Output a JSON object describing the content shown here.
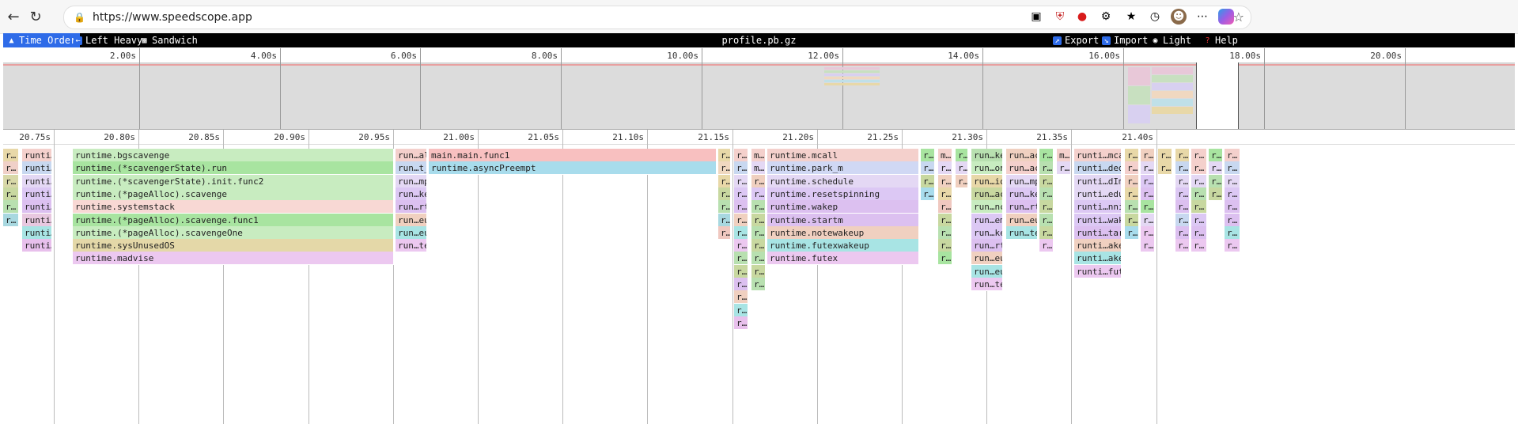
{
  "browser": {
    "url": "https://www.speedscope.app"
  },
  "toolbar": {
    "time_order": "Time Order",
    "left_heavy": "Left Heavy",
    "sandwich": "Sandwich",
    "title": "profile.pb.gz",
    "export": "Export",
    "import": "Import",
    "light": "Light",
    "help": "Help"
  },
  "minimap": {
    "ticks": [
      {
        "label": "2.00s",
        "t": 2
      },
      {
        "label": "4.00s",
        "t": 4
      },
      {
        "label": "6.00s",
        "t": 6
      },
      {
        "label": "8.00s",
        "t": 8
      },
      {
        "label": "10.00s",
        "t": 10
      },
      {
        "label": "12.00s",
        "t": 12
      },
      {
        "label": "14.00s",
        "t": 14
      },
      {
        "label": "16.00s",
        "t": 16
      },
      {
        "label": "18.00s",
        "t": 18
      },
      {
        "label": "20.00s",
        "t": 20
      }
    ],
    "range": [
      0,
      21.5
    ]
  },
  "flame": {
    "ticks": [
      {
        "label": "20.75s"
      },
      {
        "label": "20.80s"
      },
      {
        "label": "20.85s"
      },
      {
        "label": "20.90s"
      },
      {
        "label": "20.95s"
      },
      {
        "label": "21.00s"
      },
      {
        "label": "21.05s"
      },
      {
        "label": "21.10s"
      },
      {
        "label": "21.15s"
      },
      {
        "label": "21.20s"
      },
      {
        "label": "21.25s"
      },
      {
        "label": "21.30s"
      },
      {
        "label": "21.35s"
      },
      {
        "label": "21.40s"
      }
    ],
    "frames": [
      [
        "r…",
        0,
        "#e8d8a8",
        0,
        20
      ],
      [
        "r…",
        1,
        "#f0d0c8",
        0,
        20
      ],
      [
        "r…",
        2,
        "#d8d8a8",
        0,
        20
      ],
      [
        "r…",
        3,
        "#c8d8a0",
        0,
        20
      ],
      [
        "r…",
        4,
        "#b8e0b0",
        0,
        20
      ],
      [
        "r…",
        5,
        "#a8d8e0",
        0,
        20
      ],
      [
        "runti…mcall",
        0,
        "#f4d0cc",
        24,
        62
      ],
      [
        "runti…ded_m",
        1,
        "#c8d8f0",
        24,
        62
      ],
      [
        "runti…dImpl",
        2,
        "#e4d8f4",
        24,
        62
      ],
      [
        "runti…wakep",
        3,
        "#dcc8f4",
        24,
        62
      ],
      [
        "runti…tartm",
        4,
        "#dcc0f0",
        24,
        62
      ],
      [
        "runti…akeup",
        5,
        "#e8c8e0",
        24,
        62
      ],
      [
        "runti…akeup",
        6,
        "#a8e4e4",
        24,
        62
      ],
      [
        "runti…futex",
        7,
        "#e8c0ec",
        24,
        62
      ],
      [
        "runtime.bgscavenge",
        0,
        "#c8ecc0",
        88,
        494
      ],
      [
        "runtime.(*scavengerState).run",
        1,
        "#a8e4a0",
        88,
        494
      ],
      [
        "runtime.(*scavengerState).init.func2",
        2,
        "#c8ecc0",
        88,
        494
      ],
      [
        "runtime.(*pageAlloc).scavenge",
        3,
        "#c8ecc0",
        88,
        494
      ],
      [
        "runtime.systemstack",
        4,
        "#f8d8d4",
        88,
        494
      ],
      [
        "runtime.(*pageAlloc).scavenge.func1",
        5,
        "#a8e4a0",
        88,
        494
      ],
      [
        "runtime.(*pageAlloc).scavengeOne",
        6,
        "#c8ecc0",
        88,
        494
      ],
      [
        "runtime.sysUnusedOS",
        7,
        "#e4d8a8",
        88,
        494
      ],
      [
        "runtime.madvise",
        8,
        "#ecc8f0",
        88,
        494
      ],
      [
        "run…all",
        0,
        "#f4d0cc",
        496,
        536
      ],
      [
        "run…t_m",
        1,
        "#c8d8f0",
        496,
        536
      ],
      [
        "run…mpl",
        2,
        "#e4d8f4",
        496,
        536
      ],
      [
        "run…kep",
        3,
        "#dcc8f4",
        496,
        536
      ],
      [
        "run…rtm",
        4,
        "#dcc0f0",
        496,
        536
      ],
      [
        "run…eup",
        5,
        "#f0d0c0",
        496,
        536
      ],
      [
        "run…eup",
        6,
        "#a8e4e4",
        496,
        536
      ],
      [
        "run…tex",
        7,
        "#ecc8f0",
        496,
        536
      ],
      [
        "main.main.func1",
        0,
        "#f8c0c0",
        538,
        902
      ],
      [
        "runtime.asyncPreempt",
        1,
        "#a8dcec",
        538,
        902
      ],
      [
        "r…",
        0,
        "#e8d8a8",
        904,
        920
      ],
      [
        "r…",
        1,
        "#f0d8c0",
        904,
        920
      ],
      [
        "r…",
        2,
        "#e8d8a8",
        904,
        920
      ],
      [
        "r…",
        3,
        "#c8d8a0",
        904,
        920
      ],
      [
        "r…",
        4,
        "#b8e0b0",
        904,
        920
      ],
      [
        "r…",
        5,
        "#a8d8e0",
        904,
        920
      ],
      [
        "r…",
        6,
        "#f0c8c0",
        904,
        920
      ],
      [
        "r…",
        0,
        "#f4d0cc",
        924,
        942
      ],
      [
        "r…",
        1,
        "#c8d8f0",
        924,
        942
      ],
      [
        "r…",
        2,
        "#e4d8f4",
        924,
        942
      ],
      [
        "r…",
        3,
        "#dcc8f4",
        924,
        942
      ],
      [
        "r…",
        4,
        "#dcc0f0",
        924,
        942
      ],
      [
        "r…",
        5,
        "#f0d0c0",
        924,
        942
      ],
      [
        "r…",
        6,
        "#a8e4e4",
        924,
        942
      ],
      [
        "r…",
        7,
        "#ecc8f0",
        924,
        942
      ],
      [
        "r…",
        8,
        "#b8e0b0",
        924,
        942
      ],
      [
        "r…",
        9,
        "#c8d8a0",
        924,
        942
      ],
      [
        "r…",
        10,
        "#dcc0f0",
        924,
        942
      ],
      [
        "r…",
        11,
        "#f0d0c0",
        924,
        942
      ],
      [
        "r…",
        12,
        "#a8e4e4",
        924,
        942
      ],
      [
        "r…",
        13,
        "#e8c0ec",
        924,
        942
      ],
      [
        "m…",
        0,
        "#f4d0cc",
        946,
        964
      ],
      [
        "m…",
        1,
        "#e4d8f4",
        946,
        964
      ],
      [
        "r…",
        2,
        "#f0d0c0",
        946,
        964
      ],
      [
        "r…",
        3,
        "#dcc8f4",
        946,
        964
      ],
      [
        "r…",
        4,
        "#b8e0b0",
        946,
        964
      ],
      [
        "r…",
        5,
        "#c8d8a0",
        946,
        964
      ],
      [
        "r…",
        6,
        "#b8e0b0",
        946,
        964
      ],
      [
        "r…",
        7,
        "#c8d8a0",
        946,
        964
      ],
      [
        "r…",
        8,
        "#b8e0b0",
        946,
        964
      ],
      [
        "r…",
        9,
        "#c8d8a0",
        946,
        964
      ],
      [
        "r…",
        10,
        "#b8e0b0",
        946,
        964
      ],
      [
        "runtime.mcall",
        0,
        "#f4d0cc",
        966,
        1158
      ],
      [
        "runtime.park_m",
        1,
        "#d0d8f4",
        966,
        1158
      ],
      [
        "runtime.schedule",
        2,
        "#e4d8f4",
        966,
        1158
      ],
      [
        "runtime.resetspinning",
        3,
        "#dcc8f4",
        966,
        1158
      ],
      [
        "runtime.wakep",
        4,
        "#dcc0f0",
        966,
        1158
      ],
      [
        "runtime.startm",
        5,
        "#dcc0f0",
        966,
        1158
      ],
      [
        "runtime.notewakeup",
        6,
        "#f0d0c0",
        966,
        1158
      ],
      [
        "runtime.futexwakeup",
        7,
        "#a8e4e4",
        966,
        1158
      ],
      [
        "runtime.futex",
        8,
        "#ecc8f0",
        966,
        1158
      ],
      [
        "r…",
        0,
        "#a8e4a0",
        1160,
        1178
      ],
      [
        "r…",
        1,
        "#c8d8f0",
        1160,
        1178
      ],
      [
        "r…",
        2,
        "#c8d8a0",
        1160,
        1178
      ],
      [
        "r…",
        3,
        "#a8dcec",
        1160,
        1178
      ],
      [
        "m…",
        0,
        "#f4d0cc",
        1182,
        1200
      ],
      [
        "r…",
        1,
        "#e4d8f4",
        1182,
        1200
      ],
      [
        "r…",
        2,
        "#f0d0c0",
        1182,
        1200
      ],
      [
        "r…",
        3,
        "#e8d8a8",
        1182,
        1200
      ],
      [
        "r…",
        4,
        "#f0c8c0",
        1182,
        1200
      ],
      [
        "r…",
        5,
        "#c8d8a0",
        1182,
        1200
      ],
      [
        "r…",
        6,
        "#b8e0b0",
        1182,
        1200
      ],
      [
        "r…",
        7,
        "#c8d8a0",
        1182,
        1200
      ],
      [
        "r…",
        8,
        "#a8e4a0",
        1182,
        1200
      ],
      [
        "r…",
        0,
        "#a8e4a0",
        1204,
        1220
      ],
      [
        "r…",
        1,
        "#e4d8f4",
        1204,
        1220
      ],
      [
        "r…",
        2,
        "#f0d0c0",
        1204,
        1220
      ],
      [
        "run…ker",
        0,
        "#b8e0b0",
        1224,
        1264
      ],
      [
        "run…one",
        1,
        "#c8ecc0",
        1224,
        1264
      ],
      [
        "run…ion",
        2,
        "#e8d8a8",
        1224,
        1264
      ],
      [
        "run…ack",
        3,
        "#c8d8a0",
        1224,
        1264
      ],
      [
        "run…nc3",
        4,
        "#c8ecc0",
        1224,
        1264
      ],
      [
        "run…ema",
        5,
        "#dcc8f4",
        1224,
        1264
      ],
      [
        "run…kep",
        6,
        "#dcc8f4",
        1224,
        1264
      ],
      [
        "run…rtm",
        7,
        "#dcc0f0",
        1224,
        1264
      ],
      [
        "run…eup",
        8,
        "#f0d0c0",
        1224,
        1264
      ],
      [
        "run…eup",
        9,
        "#a8e4e4",
        1224,
        1264
      ],
      [
        "run…tex",
        10,
        "#ecc8f0",
        1224,
        1264
      ],
      [
        "run…ack",
        0,
        "#f0d0c0",
        1268,
        1308
      ],
      [
        "run…ack",
        1,
        "#f4d0cc",
        1268,
        1308
      ],
      [
        "run…mpl",
        2,
        "#e4d8f4",
        1268,
        1308
      ],
      [
        "run…kep",
        3,
        "#dcc8f4",
        1268,
        1308
      ],
      [
        "run…rtm",
        4,
        "#dcc0f0",
        1268,
        1308
      ],
      [
        "run…eup",
        5,
        "#f0d0c0",
        1268,
        1308
      ],
      [
        "run…tex",
        6,
        "#a8e4e4",
        1268,
        1308
      ],
      [
        "r…",
        0,
        "#a8e4a0",
        1310,
        1328
      ],
      [
        "r…",
        1,
        "#b8e0b0",
        1310,
        1328
      ],
      [
        "r…",
        2,
        "#c8d8a0",
        1310,
        1328
      ],
      [
        "r…",
        3,
        "#b8e0b0",
        1310,
        1328
      ],
      [
        "r…",
        4,
        "#c8d8a0",
        1310,
        1328
      ],
      [
        "r…",
        5,
        "#b8e0b0",
        1310,
        1328
      ],
      [
        "r…",
        6,
        "#c8d8a0",
        1310,
        1328
      ],
      [
        "r…",
        7,
        "#ecc8f0",
        1310,
        1328
      ],
      [
        "m…",
        0,
        "#f4d0cc",
        1332,
        1350
      ],
      [
        "r…",
        1,
        "#e4d8f4",
        1332,
        1350
      ],
      [
        "runti…mcall",
        0,
        "#f4d0cc",
        1354,
        1414
      ],
      [
        "runti…ded_m",
        1,
        "#c8d8f0",
        1354,
        1414
      ],
      [
        "runti…dImpl",
        2,
        "#e4d8f4",
        1354,
        1414
      ],
      [
        "runti…edule",
        3,
        "#e4d8f4",
        1354,
        1414
      ],
      [
        "runti…nning",
        4,
        "#dcc8f4",
        1354,
        1414
      ],
      [
        "runti…wakep",
        5,
        "#dcc8f4",
        1354,
        1414
      ],
      [
        "runti…tartm",
        6,
        "#dcc0f0",
        1354,
        1414
      ],
      [
        "runti…akeup",
        7,
        "#f0d0c0",
        1354,
        1414
      ],
      [
        "runti…akeup",
        8,
        "#a8e4e4",
        1354,
        1414
      ],
      [
        "runti…futex",
        9,
        "#ecc8f0",
        1354,
        1414
      ],
      [
        "r…",
        0,
        "#e8d8a8",
        1418,
        1436
      ],
      [
        "r…",
        1,
        "#f4d0cc",
        1418,
        1436
      ],
      [
        "r…",
        2,
        "#f0d0c0",
        1418,
        1436
      ],
      [
        "r…",
        3,
        "#e8d8a8",
        1418,
        1436
      ],
      [
        "r…",
        4,
        "#b8e0b0",
        1418,
        1436
      ],
      [
        "r…",
        5,
        "#c8d8a0",
        1418,
        1436
      ],
      [
        "r…",
        6,
        "#a8dcec",
        1418,
        1436
      ],
      [
        "r…",
        0,
        "#f0d0c0",
        1438,
        1456
      ],
      [
        "r…",
        1,
        "#e4d8f4",
        1438,
        1456
      ],
      [
        "r…",
        2,
        "#dcc8f4",
        1438,
        1456
      ],
      [
        "r…",
        3,
        "#dcc0f0",
        1438,
        1456
      ],
      [
        "r…",
        4,
        "#a8e4a0",
        1438,
        1456
      ],
      [
        "r…",
        5,
        "#e4d8f4",
        1438,
        1456
      ],
      [
        "r…",
        6,
        "#ecc8f0",
        1438,
        1456
      ],
      [
        "r…",
        7,
        "#ecc8f0",
        1438,
        1456
      ],
      [
        "r…",
        0,
        "#e8d8a8",
        1460,
        1478
      ],
      [
        "r…",
        1,
        "#e8d8a8",
        1460,
        1478
      ],
      [
        "r…",
        0,
        "#e8d8a8",
        1482,
        1500
      ],
      [
        "r…",
        1,
        "#c8d8f0",
        1482,
        1500
      ],
      [
        "r…",
        2,
        "#e4d8f4",
        1482,
        1500
      ],
      [
        "r…",
        3,
        "#dcc8f4",
        1482,
        1500
      ],
      [
        "r…",
        4,
        "#dcc0f0",
        1482,
        1500
      ],
      [
        "r…",
        5,
        "#c8d8f0",
        1482,
        1500
      ],
      [
        "r…",
        6,
        "#dcc0f0",
        1482,
        1500
      ],
      [
        "r…",
        7,
        "#ecc8f0",
        1482,
        1500
      ],
      [
        "r…",
        0,
        "#f4d0cc",
        1502,
        1522
      ],
      [
        "r…",
        1,
        "#f4d0cc",
        1502,
        1522
      ],
      [
        "r…",
        2,
        "#e4d8f4",
        1502,
        1522
      ],
      [
        "r…",
        3,
        "#b8e0b0",
        1502,
        1522
      ],
      [
        "r…",
        4,
        "#c8d8a0",
        1502,
        1522
      ],
      [
        "r…",
        5,
        "#dcc8f4",
        1502,
        1522
      ],
      [
        "r…",
        6,
        "#dcc0f0",
        1502,
        1522
      ],
      [
        "r…",
        7,
        "#ecc8f0",
        1502,
        1522
      ],
      [
        "r…",
        0,
        "#a8e4a0",
        1524,
        1542
      ],
      [
        "r…",
        1,
        "#e4d8f4",
        1524,
        1542
      ],
      [
        "r…",
        2,
        "#b8e0b0",
        1524,
        1542
      ],
      [
        "r…",
        3,
        "#c8d8a0",
        1524,
        1542
      ],
      [
        "r…",
        0,
        "#f4d0cc",
        1544,
        1564
      ],
      [
        "r…",
        1,
        "#c8d8f0",
        1544,
        1564
      ],
      [
        "r…",
        2,
        "#e4d8f4",
        1544,
        1564
      ],
      [
        "r…",
        3,
        "#dcc8f4",
        1544,
        1564
      ],
      [
        "r…",
        4,
        "#dcc0f0",
        1544,
        1564
      ],
      [
        "r…",
        5,
        "#dcc0f0",
        1544,
        1564
      ],
      [
        "r…",
        6,
        "#a8e4e4",
        1544,
        1564
      ],
      [
        "r…",
        7,
        "#ecc8f0",
        1544,
        1564
      ]
    ]
  }
}
